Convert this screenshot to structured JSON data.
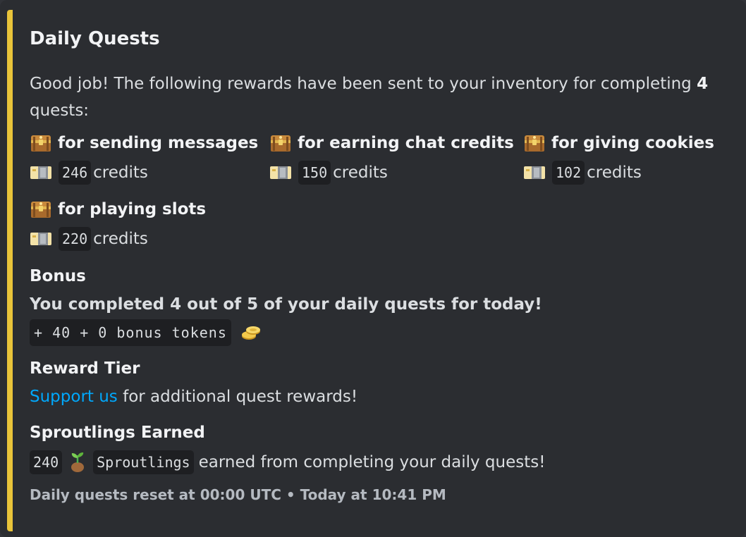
{
  "embed": {
    "accent_color": "#e9c43a",
    "title": "Daily Quests",
    "description_prefix": "Good job! The following rewards have been sent to your inventory for completing ",
    "description_count": "4",
    "description_suffix": "quests:",
    "quests": [
      {
        "name": "for sending messages",
        "amount": "246",
        "unit": "credits",
        "icon": "treasure-chest-icon"
      },
      {
        "name": "for earning chat credits",
        "amount": "150",
        "unit": "credits",
        "icon": "treasure-chest-icon"
      },
      {
        "name": "for giving cookies",
        "amount": "102",
        "unit": "credits",
        "icon": "treasure-chest-icon"
      },
      {
        "name": "for playing slots",
        "amount": "220",
        "unit": "credits",
        "icon": "treasure-chest-icon"
      }
    ],
    "bonus": {
      "title": "Bonus",
      "summary": "You completed 4 out of 5 of your daily quests for today!",
      "tokens": "+ 40 + 0 bonus tokens"
    },
    "reward_tier": {
      "title": "Reward Tier",
      "link": "Support us",
      "text": "for additional quest rewards!"
    },
    "sproutlings": {
      "title": "Sproutlings Earned",
      "amount": "240",
      "unit": "Sproutlings",
      "text": "earned from completing your daily quests!"
    },
    "footer": {
      "text": "Daily quests reset at 00:00 UTC",
      "separator": "•",
      "timestamp": "Today at 10:41 PM"
    }
  }
}
